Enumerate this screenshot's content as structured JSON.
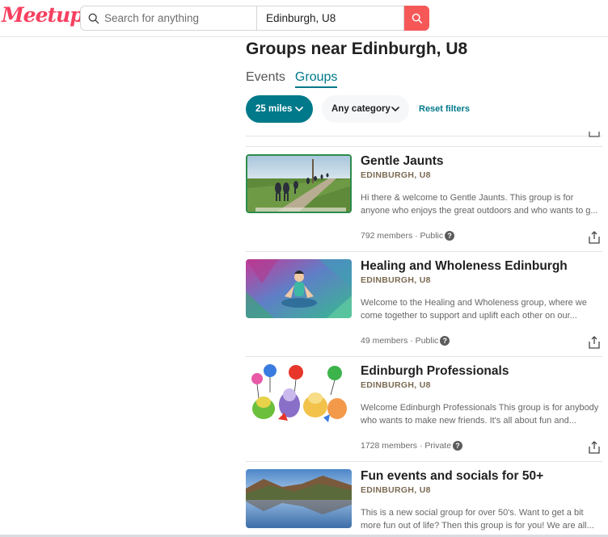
{
  "header": {
    "logo": "Meetup",
    "search_placeholder": "Search for anything",
    "location_value": "Edinburgh, U8"
  },
  "page": {
    "title": "Groups near Edinburgh, U8",
    "tabs": [
      {
        "label": "Events",
        "active": false
      },
      {
        "label": "Groups",
        "active": true
      }
    ]
  },
  "filters": {
    "distance": "25 miles",
    "category": "Any category",
    "reset": "Reset filters"
  },
  "groups": [
    {
      "name": "Gentle Jaunts",
      "location": "EDINBURGH, U8",
      "desc1": "Hi there & welcome to Gentle Jaunts. This group is for",
      "desc2": "anyone who enjoys the great outdoors and who wants to g...",
      "meta": "792 members · Public",
      "image": "hikers-on-path"
    },
    {
      "name": "Healing and Wholeness Edinburgh",
      "location": "EDINBURGH, U8",
      "desc1": "Welcome to the Healing and Wholeness group, where we",
      "desc2": "come together to support and uplift each other on our...",
      "meta": "49 members · Public",
      "image": "meditation-figure"
    },
    {
      "name": "Edinburgh Professionals",
      "location": "EDINBURGH, U8",
      "desc1": "Welcome Edinburgh Professionals This group is for anybody",
      "desc2": "who wants to make new friends. It's all about fun and...",
      "meta": "1728 members · Private",
      "image": "cartoon-party-animals"
    },
    {
      "name": "Fun events and socials for 50+",
      "location": "EDINBURGH, U8",
      "desc1": "This is a new social group for over 50's. Want to get a bit",
      "desc2": "more fun out of life? Then this group is for you! We are all...",
      "meta": "",
      "image": "mountain-lake"
    }
  ],
  "colors": {
    "brand": "#f64060",
    "teal": "#00798a",
    "search_button": "#f65858"
  }
}
